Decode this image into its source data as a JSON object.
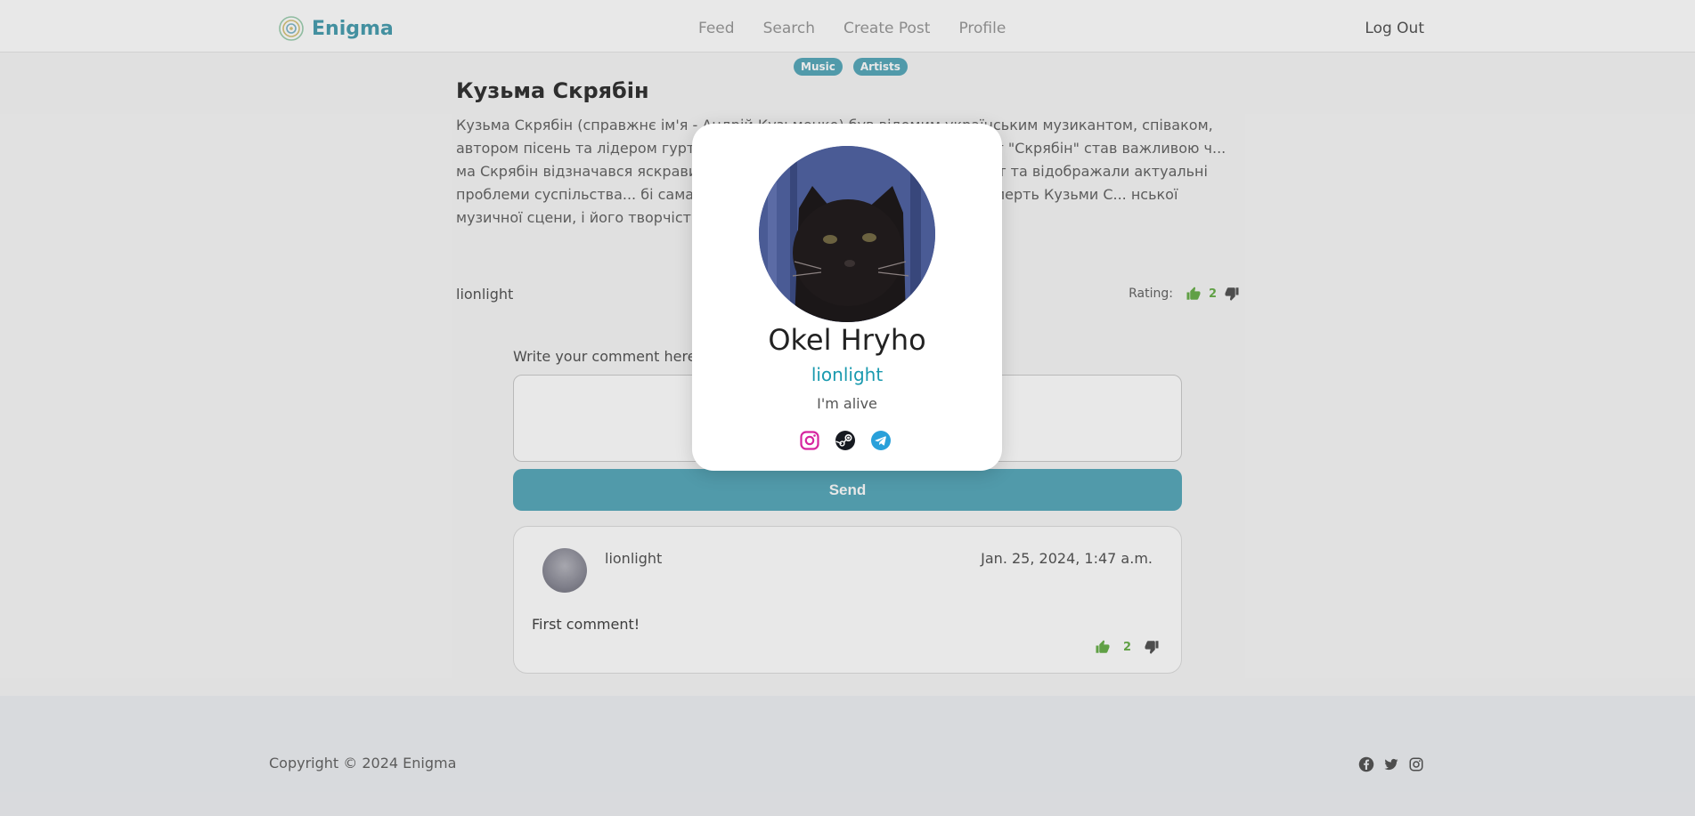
{
  "navbar": {
    "brand": "Enigma",
    "links": [
      "Feed",
      "Search",
      "Create Post",
      "Profile"
    ],
    "logout": "Log Out"
  },
  "post": {
    "tags": [
      "Music",
      "Artists"
    ],
    "title": "Кузьма Скрябін",
    "body": "Кузьма Скрябін (справжнє ім'я - Андрій Кузьменко) був відомим українським музикантом, співаком, автором пісень та лідером гурт... року і помер 2 лютого 2015 року. Гурт \"Скрябін\" став важливою ч... ма Скрябін відзначався яскравим та харизматичним ви... глибокий зміст та відображали актуальні проблеми суспільства... бі сама\", стали популярними серед слухачів. Смерть Кузьми С... нської музичної сцени, і його творчість залишається пам'ятно...",
    "author": "lionlight",
    "rating_label": "Rating:",
    "rating": 2
  },
  "comment_form": {
    "label": "Write your comment here",
    "placeholder": "",
    "send_label": "Send"
  },
  "comments": [
    {
      "author": "lionlight",
      "date": "Jan. 25, 2024, 1:47 a.m.",
      "text": "First comment!",
      "rating": 2
    }
  ],
  "footer": {
    "copyright": "Copyright © 2024 Enigma",
    "icons": [
      "facebook-icon",
      "twitter-icon",
      "instagram-icon"
    ]
  },
  "profile_modal": {
    "name": "Okel Hryho",
    "username": "lionlight",
    "status": "I'm alive",
    "socials": [
      "instagram-icon",
      "steam-icon",
      "telegram-icon"
    ]
  },
  "colors": {
    "accent": "#5aaabb",
    "username": "#1a9aaf",
    "like": "#6ab04c"
  }
}
